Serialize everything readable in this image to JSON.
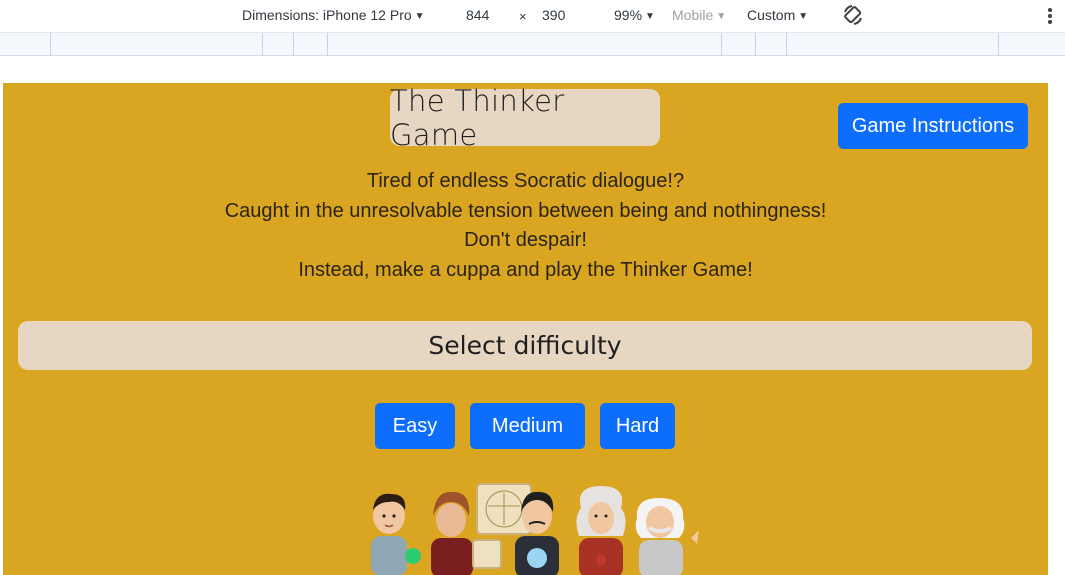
{
  "devtools": {
    "dimensions_label": "Dimensions: iPhone 12 Pro",
    "width_value": "844",
    "times_symbol": "×",
    "height_value": "390",
    "zoom_value": "99%",
    "mode_label": "Mobile",
    "throttle_label": "Custom",
    "icons": [
      "caret-down-icon",
      "rotate-icon",
      "more-vert-icon"
    ]
  },
  "game": {
    "title": "The Thinker Game",
    "instructions_button": "Game Instructions",
    "intro_lines": [
      "Tired of endless Socratic dialogue!?",
      "Caught in the unresolvable tension between being and nothingness!",
      "Don't despair!",
      "Instead, make a cuppa and play the Thinker Game!"
    ],
    "difficulty_heading": "Select difficulty",
    "difficulty_buttons": [
      "Easy",
      "Medium",
      "Hard"
    ]
  },
  "colors": {
    "page_background": "#daa520",
    "panel_background": "#e6d6c2",
    "button_primary": "#0d6efd"
  }
}
